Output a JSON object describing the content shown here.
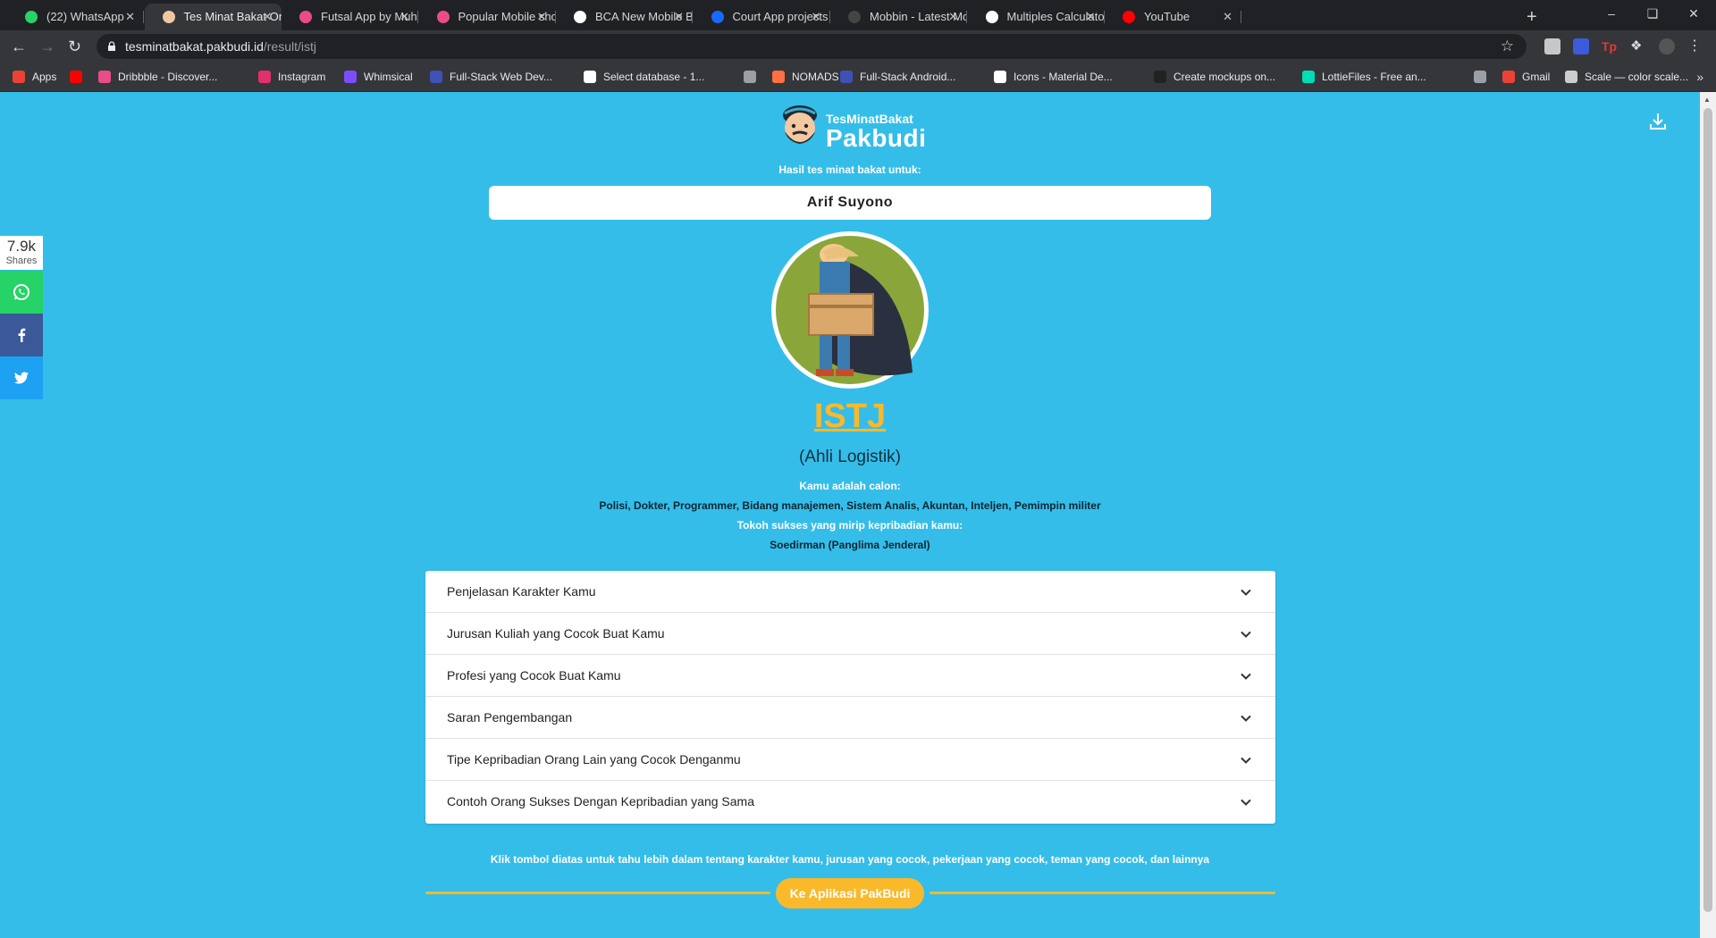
{
  "browser": {
    "tabs": [
      {
        "title": "(22) WhatsApp",
        "color": "#25d366"
      },
      {
        "title": "Tes Minat Bakat Online",
        "color": "#f0c8a0",
        "active": true
      },
      {
        "title": "Futsal App by Muhamm",
        "color": "#ea4c89"
      },
      {
        "title": "Popular Mobile shots o",
        "color": "#ea4c89"
      },
      {
        "title": "BCA New Mobile Banki",
        "color": "#ffffff"
      },
      {
        "title": "Court App projects | Ph",
        "color": "#1769ff"
      },
      {
        "title": "Mobbin - Latest Mobile",
        "color": "#444444"
      },
      {
        "title": "Multiples Calculator",
        "color": "#ffffff"
      },
      {
        "title": "YouTube",
        "color": "#ff0000"
      }
    ],
    "url_host": "tesminatbakat.pakbudi.id",
    "url_path": "/result/istj",
    "bookmarks": [
      {
        "label": "Apps",
        "color": "#ea4335"
      },
      {
        "label": "",
        "color": "#ff0000"
      },
      {
        "label": "Dribbble - Discover...",
        "color": "#ea4c89"
      },
      {
        "label": "Instagram",
        "color": "#e1306c"
      },
      {
        "label": "Whimsical",
        "color": "#7c4dff"
      },
      {
        "label": "Full-Stack Web Dev...",
        "color": "#3f51b5"
      },
      {
        "label": "Select database - 1...",
        "color": "#ffffff"
      },
      {
        "label": "",
        "color": "#9aa0a6"
      },
      {
        "label": "NOMADS",
        "color": "#ff7043"
      },
      {
        "label": "Full-Stack Android...",
        "color": "#3f51b5"
      },
      {
        "label": "Icons - Material De...",
        "color": "#ffffff"
      },
      {
        "label": "Create mockups on...",
        "color": "#222222"
      },
      {
        "label": "LottieFiles - Free an...",
        "color": "#00ddb3"
      },
      {
        "label": "",
        "color": "#9aa0a6"
      },
      {
        "label": "Gmail",
        "color": "#ea4335"
      },
      {
        "label": "Scale — color scale...",
        "color": "#cccccc"
      }
    ]
  },
  "header": {
    "brand_small": "TesMinatBakat",
    "brand_big": "Pakbudi"
  },
  "result": {
    "for_label": "Hasil tes minat bakat untuk:",
    "name": "Arif Suyono",
    "type": "ISTJ",
    "type_title": "(Ahli Logistik)",
    "candidate_label": "Kamu adalah calon:",
    "candidates": "Polisi, Dokter, Programmer, Bidang manajemen, Sistem Analis, Akuntan, Inteljen, Pemimpin militer",
    "figure_label": "Tokoh sukses yang mirip kepribadian kamu:",
    "figure": "Soedirman (Panglima Jenderal)"
  },
  "accordion": [
    "Penjelasan Karakter Kamu",
    "Jurusan Kuliah yang Cocok Buat Kamu",
    "Profesi yang Cocok Buat Kamu",
    "Saran Pengembangan",
    "Tipe Kepribadian Orang Lain yang Cocok Denganmu",
    "Contoh Orang Sukses Dengan Kepribadian yang Sama"
  ],
  "hint": "Klik tombol diatas untuk tahu lebih dalam tentang karakter kamu, jurusan yang cocok, pekerjaan yang cocok, teman yang cocok, dan lainnya",
  "cta_label": "Ke Aplikasi PakBudi",
  "share": {
    "count": "7.9k",
    "count_label": "Shares",
    "buttons": [
      {
        "name": "whatsapp",
        "color": "#25d366"
      },
      {
        "name": "facebook",
        "color": "#3b5998"
      },
      {
        "name": "twitter",
        "color": "#1da1f2"
      }
    ]
  },
  "colors": {
    "page_bg": "#35bde9",
    "accent": "#f9b92b"
  }
}
